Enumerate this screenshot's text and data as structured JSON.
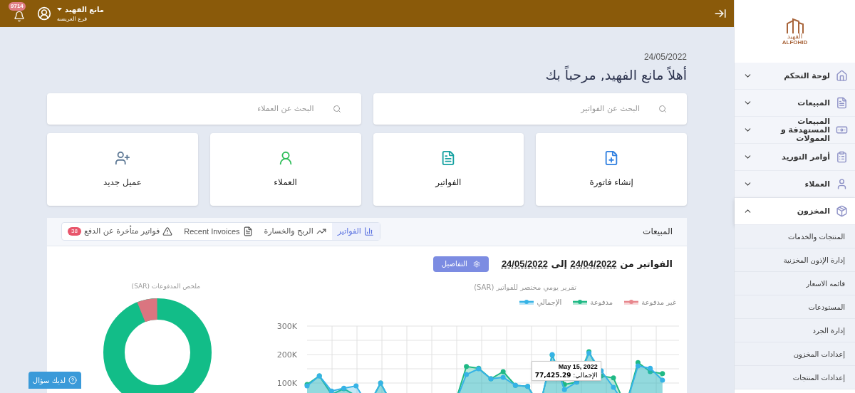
{
  "topbar": {
    "user_name": "مانع الفهيد",
    "branch": "فرع العريسه",
    "notifications": "9714"
  },
  "greeting": {
    "date": "24/05/2022",
    "title": "أهلاً مانع الفهيد, مرحباً بك"
  },
  "search": [
    {
      "placeholder": "البحث عن الفواتير"
    },
    {
      "placeholder": "البحث عن العملاء"
    }
  ],
  "shortcuts": [
    {
      "label": "إنشاء فاتورة"
    },
    {
      "label": "الفواتير"
    },
    {
      "label": "العملاء"
    },
    {
      "label": "عميل جديد"
    }
  ],
  "sidebar": {
    "logo": {
      "arabic": "الفهيد",
      "latin": "ALFOHID"
    },
    "items": [
      {
        "label": "لوحة التحكم",
        "expanded": false
      },
      {
        "label": "المبيعات",
        "expanded": false
      },
      {
        "label": "المبيعات المستهدفة و العمولات",
        "expanded": false
      },
      {
        "label": "أوامر التوريد",
        "expanded": false
      },
      {
        "label": "العملاء",
        "expanded": false
      },
      {
        "label": "المخزون",
        "expanded": true,
        "children": [
          {
            "label": "المنتجات والخدمات"
          },
          {
            "label": "إدارة الإذون المخزنية"
          },
          {
            "label": "قائمه الاسعار"
          },
          {
            "label": "المستودعات"
          },
          {
            "label": "إدارة الجرد"
          },
          {
            "label": "إعدادات المخزون"
          },
          {
            "label": "إعدادات المنتجات"
          }
        ]
      }
    ]
  },
  "sales": {
    "title": "المبيعات",
    "tabs": [
      {
        "label": "الفواتير",
        "selected": true
      },
      {
        "label": "الربح والخسارة",
        "selected": false
      },
      {
        "label": "Recent Invoices",
        "selected": false
      },
      {
        "label": "فواتير متأخرة عن الدفع",
        "selected": false,
        "badge": "38"
      }
    ],
    "range": {
      "prefix": "الفواتير من",
      "from": "24/04/2022",
      "connector": "إلى",
      "to": "24/05/2022"
    },
    "details_button": "التفاصيل",
    "line_chart": {
      "chart_data": {
        "type": "area",
        "title": "تقرير يومي مختصر للفواتير (SAR)",
        "grid": true,
        "legend": "top",
        "ylim": [
          0,
          300000
        ],
        "yticks": [
          {
            "value": 100000,
            "label": "100K"
          },
          {
            "value": 200000,
            "label": "200K"
          },
          {
            "value": 300000,
            "label": "300K"
          }
        ],
        "series": [
          {
            "name": "غير مدفوعة",
            "color": "#e8878d",
            "values": [
              null,
              null,
              null,
              null,
              null,
              null,
              null,
              null,
              null,
              null,
              null,
              null,
              null,
              null,
              null,
              null,
              null,
              null,
              null,
              null,
              null,
              null,
              null,
              null,
              null,
              null,
              null,
              null,
              null,
              null
            ]
          },
          {
            "name": "مدفوعة",
            "color": "#1fb985",
            "values": [
              95000,
              125000,
              60000,
              80000,
              55000,
              20000,
              100000,
              20000,
              0,
              0,
              0,
              0,
              20000,
              158000,
              152000,
              115000,
              140000,
              92000,
              88000,
              20000,
              198000,
              95000,
              103000,
              210000,
              125000,
              118000,
              20000,
              172000,
              140000,
              133000
            ]
          },
          {
            "name": "الإجمالي",
            "color": "#36b3e6",
            "values": [
              90000,
              125000,
              72000,
              82000,
              90000,
              20000,
              100000,
              20000,
              0,
              0,
              0,
              0,
              20000,
              130000,
              150000,
              115000,
              120000,
              92000,
              88000,
              20000,
              200000,
              77000,
              103000,
              205000,
              143000,
              85000,
              20000,
              160000,
              152000,
              110000
            ]
          }
        ]
      },
      "tooltip": {
        "date": "May 15, 2022",
        "value": "الإجمالي: **77,425.29**"
      }
    },
    "donut": {
      "title": "ملخص المدفوعات (SAR)"
    }
  },
  "help_button": "لديك سؤال"
}
